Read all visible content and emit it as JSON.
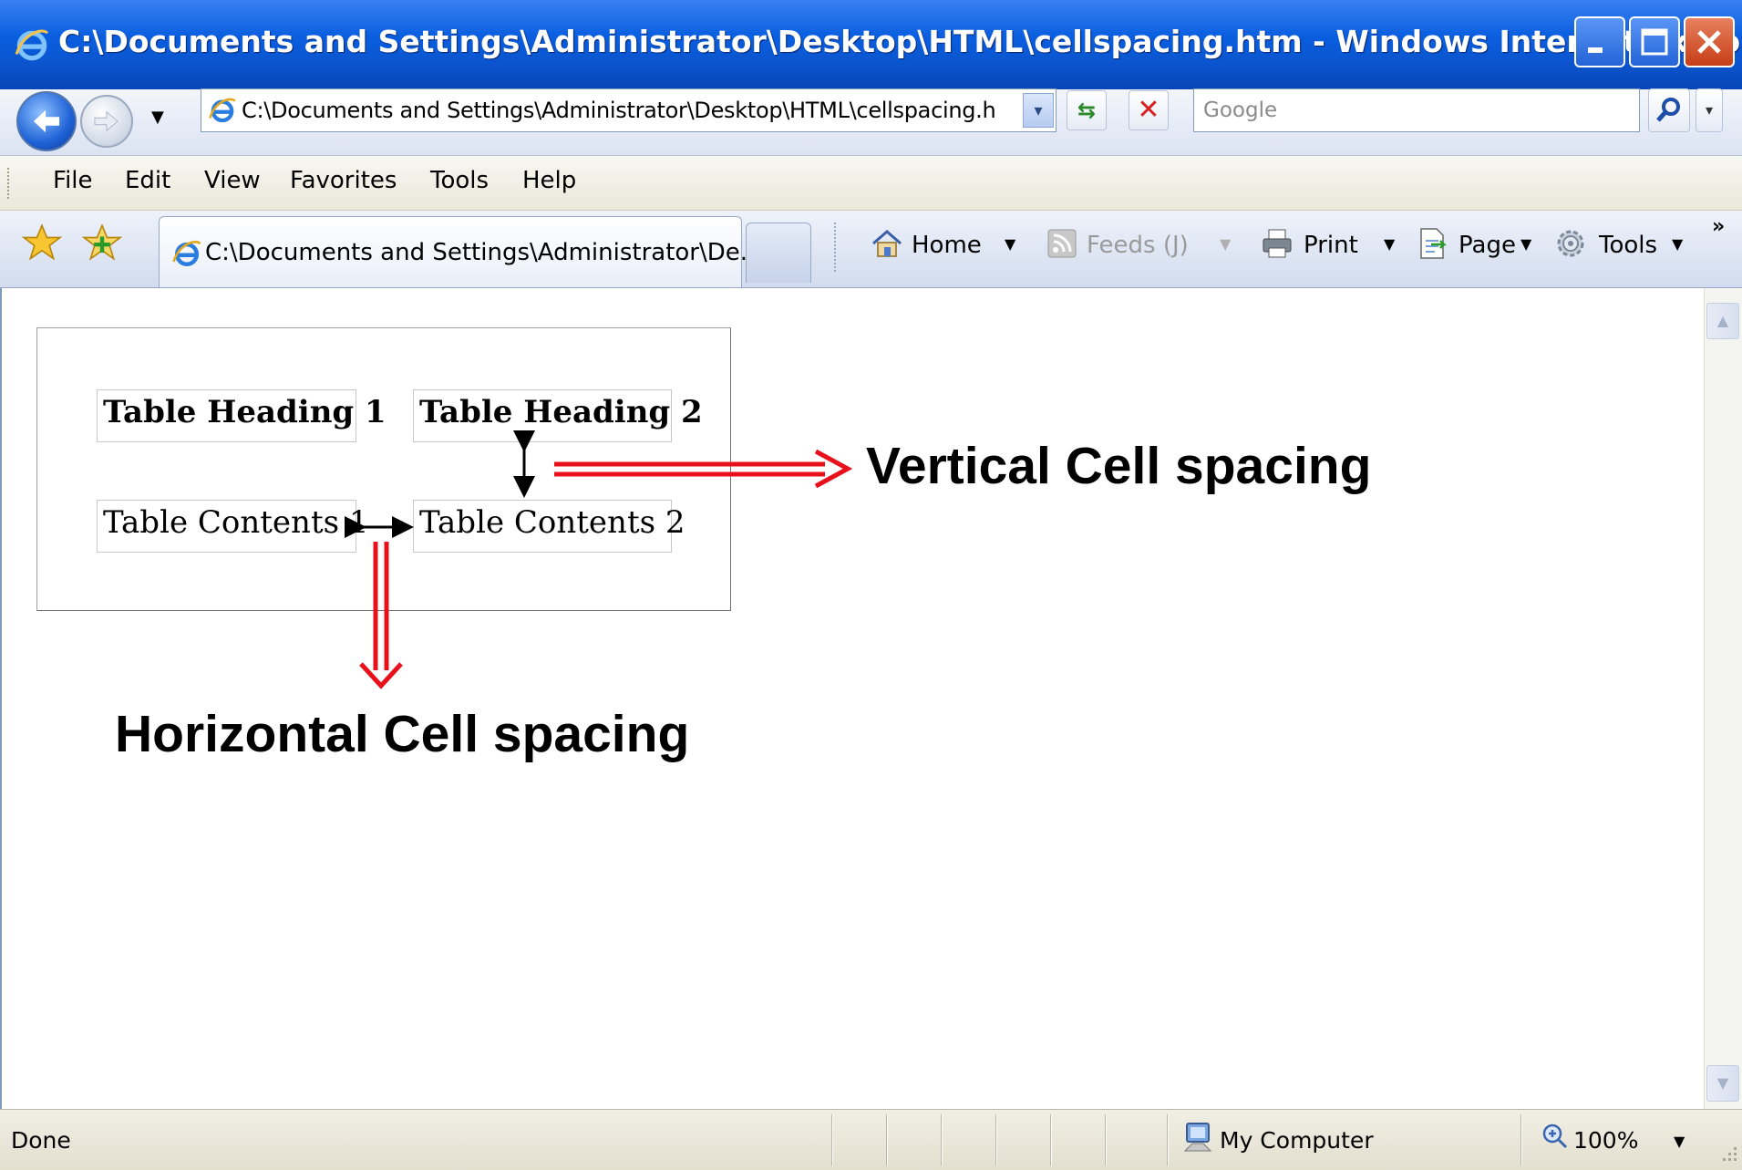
{
  "window": {
    "title": "C:\\Documents and Settings\\Administrator\\Desktop\\HTML\\cellspacing.htm - Windows Internet Explorer"
  },
  "address_bar": {
    "url": "C:\\Documents and Settings\\Administrator\\Desktop\\HTML\\cellspacing.h"
  },
  "search": {
    "placeholder": "Google"
  },
  "menu": {
    "items": [
      "File",
      "Edit",
      "View",
      "Favorites",
      "Tools",
      "Help"
    ]
  },
  "tab": {
    "label": "C:\\Documents and Settings\\Administrator\\De..."
  },
  "command_bar": {
    "home": "Home",
    "feeds": "Feeds (J)",
    "print": "Print",
    "page": "Page",
    "tools": "Tools"
  },
  "page": {
    "table": {
      "headers": [
        "Table Heading 1",
        "Table Heading 2"
      ],
      "rows": [
        [
          "Table Contents 1",
          "Table Contents 2"
        ]
      ]
    },
    "annotations": {
      "vertical": "Vertical Cell spacing",
      "horizontal": "Horizontal Cell spacing"
    },
    "arrow_color": "#e8101a"
  },
  "status_bar": {
    "status": "Done",
    "zone": "My Computer",
    "zoom": "100%"
  },
  "colors": {
    "titlebar": "#0a5fe0",
    "chrome": "#ece9d8",
    "accent_red": "#e8101a"
  }
}
